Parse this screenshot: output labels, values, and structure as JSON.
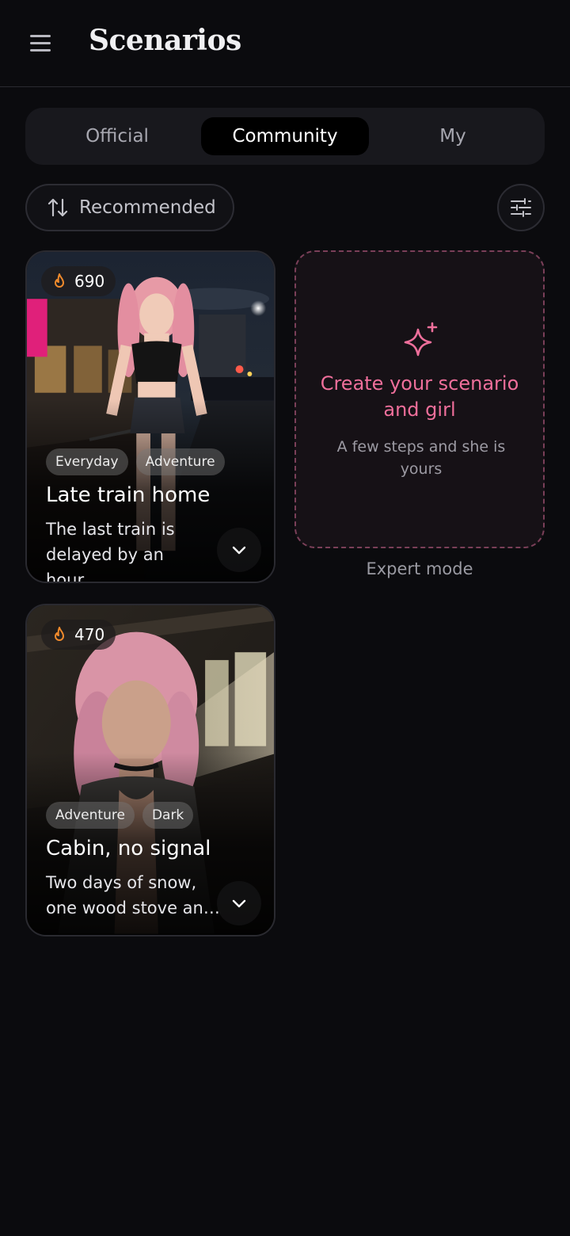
{
  "header": {
    "title": "Scenarios",
    "menu_icon": "hamburger-menu-icon"
  },
  "tabs": [
    {
      "label": "Official",
      "active": false
    },
    {
      "label": "Community",
      "active": true
    },
    {
      "label": "My",
      "active": false
    }
  ],
  "sort": {
    "label": "Recommended",
    "icon": "sort-arrows-icon"
  },
  "filter": {
    "icon": "sliders-icon"
  },
  "cards": [
    {
      "count": "690",
      "tags": [
        "Everyday",
        "Adventure"
      ],
      "title": "Late train home",
      "desc_line1": "The last train is",
      "desc_line2": "delayed by an hour…"
    },
    {
      "count": "470",
      "tags": [
        "Adventure",
        "Dark"
      ],
      "title": "Cabin, no signal",
      "desc_line1": "Two days of snow,",
      "desc_line2": "one wood stove an…"
    }
  ],
  "create": {
    "title_line1": "Create your scenario",
    "title_line2": "and girl",
    "subtitle_line1": "A few steps and she is",
    "subtitle_line2": "yours",
    "icon": "sparkle-icon"
  },
  "expert_link": "Expert mode",
  "colors": {
    "accent": "#ef6f9b",
    "background": "#0b0b0e",
    "tab_active": "#000000",
    "fire": "#f08a2c"
  }
}
